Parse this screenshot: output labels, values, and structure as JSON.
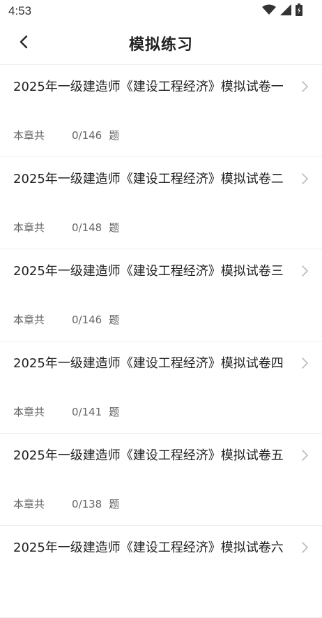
{
  "status": {
    "time": "4:53",
    "icons": [
      "wifi-icon",
      "signal-icon",
      "battery-icon"
    ]
  },
  "header": {
    "title": "模拟练习",
    "back_icon": "chevron-left-icon"
  },
  "items": [
    {
      "title": "2025年一级建造师《建设工程经济》模拟试卷一",
      "label": "本章共",
      "count": "0/146",
      "unit": "题"
    },
    {
      "title": "2025年一级建造师《建设工程经济》模拟试卷二",
      "label": "本章共",
      "count": "0/148",
      "unit": "题"
    },
    {
      "title": "2025年一级建造师《建设工程经济》模拟试卷三",
      "label": "本章共",
      "count": "0/146",
      "unit": "题"
    },
    {
      "title": "2025年一级建造师《建设工程经济》模拟试卷四",
      "label": "本章共",
      "count": "0/141",
      "unit": "题"
    },
    {
      "title": "2025年一级建造师《建设工程经济》模拟试卷五",
      "label": "本章共",
      "count": "0/138",
      "unit": "题"
    },
    {
      "title": "2025年一级建造师《建设工程经济》模拟试卷六",
      "label": "",
      "count": "",
      "unit": ""
    }
  ],
  "colors": {
    "text": "#222222",
    "meta": "#666666",
    "divider": "#eeeeee",
    "chevron": "#bbbbbb"
  }
}
